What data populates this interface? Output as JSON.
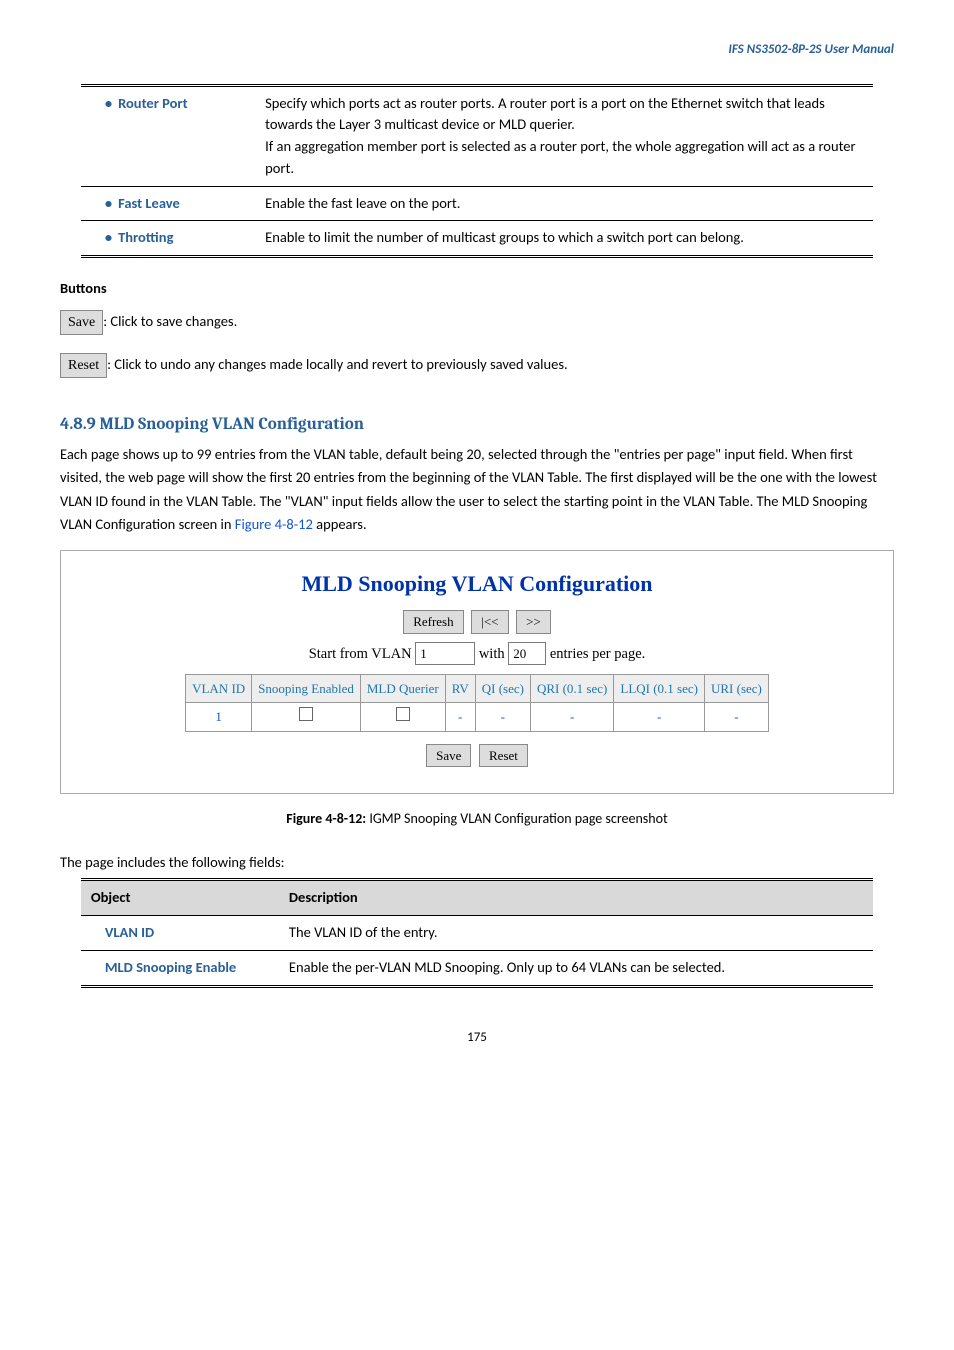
{
  "page_header": "IFS  NS3502-8P-2S  User  Manual",
  "table1": {
    "rows": [
      {
        "label": "Router Port",
        "desc": "Specify which ports act as router ports. A router port is a port on the Ethernet switch that leads towards the Layer 3 multicast device or MLD querier.\nIf an aggregation member port is selected as a router port, the whole aggregation will act as a router port."
      },
      {
        "label": "Fast Leave",
        "desc": "Enable the fast leave on the port."
      },
      {
        "label": "Throtting",
        "desc": "Enable to limit the number of multicast groups to which a switch port can belong."
      }
    ]
  },
  "buttons_header": "Buttons",
  "save_btn": "Save",
  "save_btn_note": ": Click to save changes.",
  "reset_btn": "Reset",
  "reset_btn_note": ": Click to undo any changes made locally and revert to previously saved values.",
  "section_title": "4.8.9 MLD Snooping VLAN Configuration",
  "section_body_1": "Each page shows up to 99 entries from the VLAN table, default being 20, selected through the \"entries per page\" input field. When first visited, the web page will show the first 20 entries from the beginning of the VLAN Table. The first displayed will be the one with the lowest VLAN ID found in the VLAN Table. The \"VLAN\" input fields allow the user to select the starting point in the VLAN Table. The MLD Snooping VLAN Configuration screen in ",
  "fig_link": "Figure 4-8-12",
  "section_body_2": " appears.",
  "config": {
    "title": "MLD Snooping VLAN Configuration",
    "refresh": "Refresh",
    "prev": "|<<",
    "next": ">>",
    "start_label_pre": "Start from VLAN",
    "start_val": "1",
    "with_label": "with",
    "per_page_val": "20",
    "entries_label": "entries per page.",
    "headers": [
      "VLAN ID",
      "Snooping Enabled",
      "MLD Querier",
      "RV",
      "QI (sec)",
      "QRI (0.1 sec)",
      "LLQI (0.1 sec)",
      "URI (sec)"
    ],
    "row1_id": "1",
    "dash": "-",
    "save": "Save",
    "reset": "Reset"
  },
  "figure_caption_bold": "Figure 4-8-12:",
  "figure_caption_rest": " IGMP Snooping VLAN Configuration page screenshot",
  "fields_intro": "The page includes the following fields:",
  "table2": {
    "h1": "Object",
    "h2": "Description",
    "rows": [
      {
        "label": "VLAN ID",
        "desc": "The VLAN ID of the entry."
      },
      {
        "label": "MLD Snooping Enable",
        "desc": "Enable the per-VLAN MLD Snooping. Only up to 64 VLANs can be selected."
      }
    ]
  },
  "page_number": "175"
}
